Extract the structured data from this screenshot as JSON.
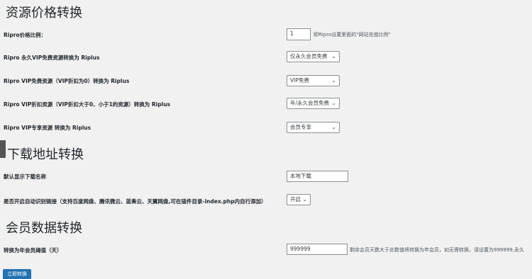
{
  "section1": {
    "title": "资源价格转换",
    "price_ratio": {
      "label": "Ripro价格比例：",
      "value": "1",
      "desc": "即Ripro设置里面的\"网站充值比例\""
    },
    "permanent_vip": {
      "label": "Ripro 永久VIP免费资源转换为 Riplus",
      "selected": "仅永久会员免费"
    },
    "vip_free": {
      "label": "Ripro VIP免费资源（VIP折扣为0）转换为 Riplus",
      "selected": "VIP免费"
    },
    "vip_discount": {
      "label": "Ripro VIP折扣资源（VIP折扣大于0、小于1的资源）转换为 Riplus",
      "selected": "年/永久会员免费"
    },
    "vip_exclusive": {
      "label": "Ripro VIP专享资源 转换为 Riplus",
      "selected": "会员专享"
    }
  },
  "section2": {
    "title": "下载地址转换",
    "default_name": {
      "label": "默认显示下载名称",
      "value": "本地下载"
    },
    "auto_detect": {
      "label": "是否开启自动识别链接（支持百度网盘、腾讯微云、蓝奏云、天翼网盘,可在插件目录-index.php内自行添加）",
      "selected": "开启"
    }
  },
  "section3": {
    "title": "会员数据转换",
    "annual_threshold": {
      "label": "转换为年会员阈值（天）",
      "value": "999999",
      "desc": "剩余会员天数大于此数值将转换为年会员，如无需转换，请设置为999999,永久"
    }
  },
  "submit_label": "立即转换"
}
